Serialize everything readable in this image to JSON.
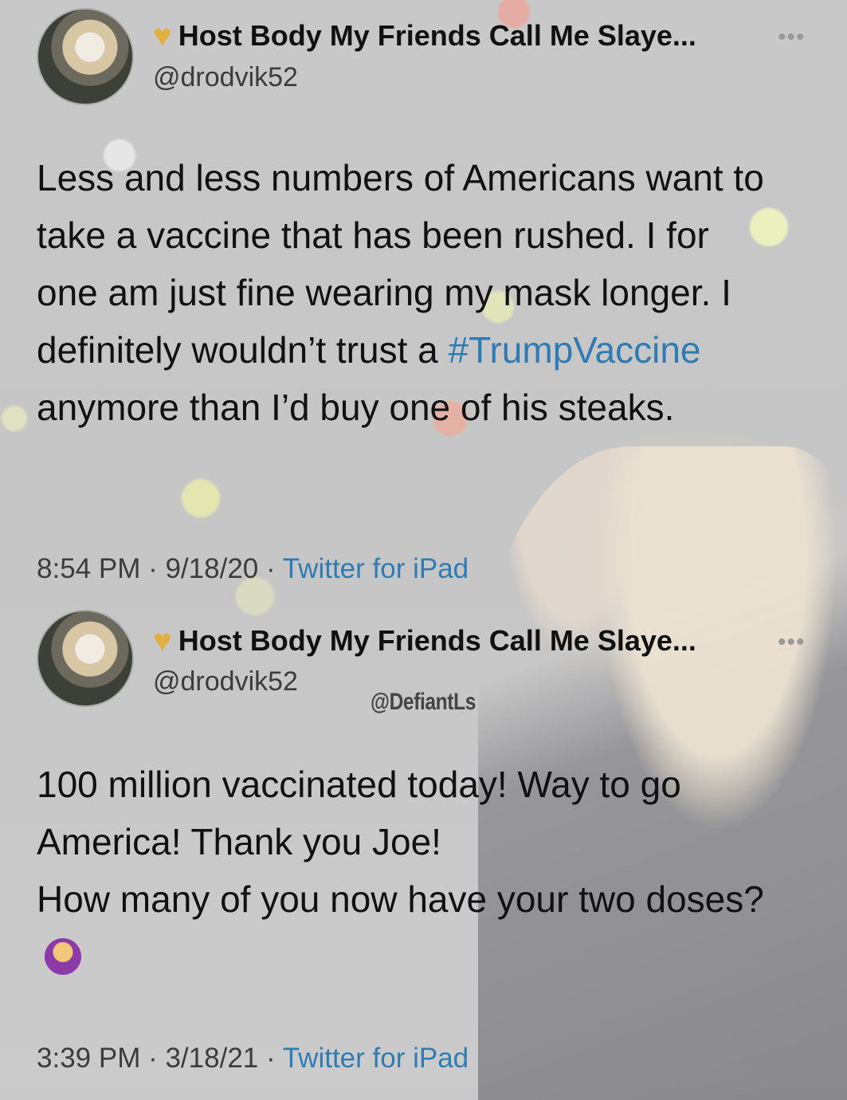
{
  "tweets": [
    {
      "name": "Host Body My Friends Call Me Slaye...",
      "handle": "@drodvik52",
      "more": "•••",
      "text_before": "Less and less numbers of Americans want to take a vaccine that has been rushed. I for one am just fine wearing my mask longer. I definitely wouldn’t trust a ",
      "hashtag": "#TrumpVaccine",
      "text_after": " anymore than I’d buy one of his steaks.",
      "time": "8:54 PM",
      "date": "9/18/20",
      "sep": " · ",
      "source": "Twitter for iPad"
    },
    {
      "name": "Host Body My Friends Call Me Slaye...",
      "handle": "@drodvik52",
      "more": "•••",
      "text_line1": "100 million vaccinated today! Way to go America! Thank you Joe!",
      "text_line2": "How many of you now have your two doses?",
      "time": "3:39 PM",
      "date": "3/18/21",
      "sep": " · ",
      "source": "Twitter for iPad"
    }
  ],
  "watermark": "@DefiantLs",
  "icons": {
    "heart": "yellow-heart-icon",
    "emoji": "person-raising-hand-icon",
    "more": "more-icon"
  },
  "colors": {
    "link": "#2f7bb3",
    "heart": "#e0b040"
  }
}
